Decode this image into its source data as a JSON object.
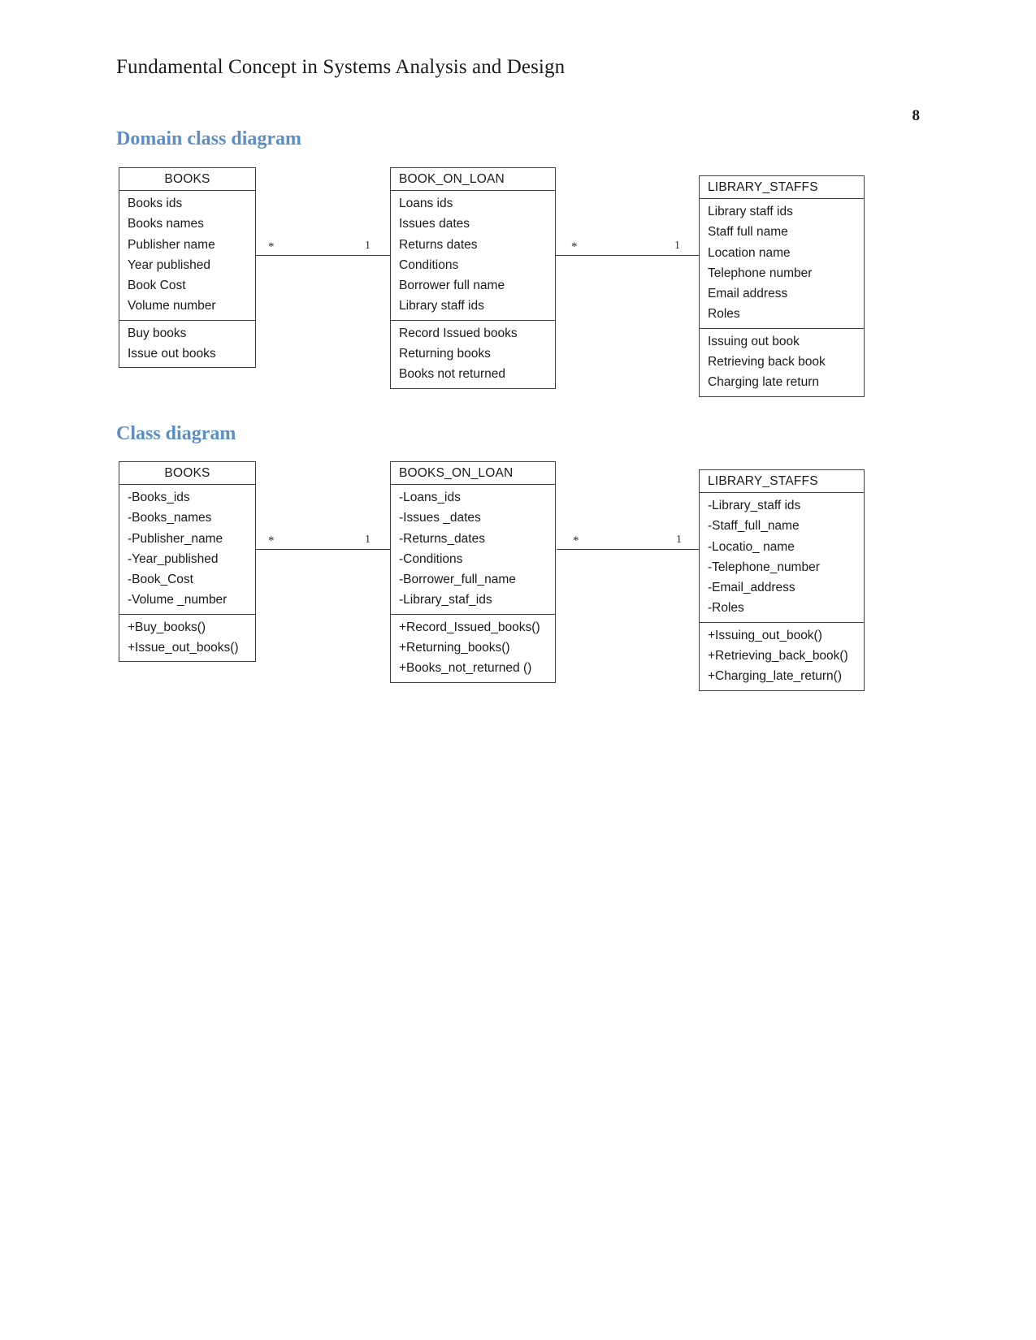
{
  "header": {
    "title": "Fundamental Concept in Systems Analysis and Design",
    "page_number": "8"
  },
  "sections": [
    {
      "id": "domain",
      "heading": "Domain class diagram",
      "classes": [
        {
          "name": "BOOKS",
          "attributes": [
            "Books ids",
            "Books names",
            "Publisher name",
            "Year published",
            "Book Cost",
            "Volume number"
          ],
          "operations": [
            "Buy books",
            "Issue out books"
          ]
        },
        {
          "name": "BOOK_ON_LOAN",
          "attributes": [
            "Loans ids",
            "Issues dates",
            "Returns dates",
            "Conditions",
            "Borrower full  name",
            "Library staff ids"
          ],
          "operations": [
            "Record Issued books",
            "Returning books",
            "Books not returned"
          ]
        },
        {
          "name": "LIBRARY_STAFFS",
          "attributes": [
            "Library staff ids",
            "Staff full name",
            "Location name",
            "Telephone number",
            "Email address",
            "Roles"
          ],
          "operations": [
            "Issuing out book",
            "Retrieving back book",
            "Charging late return"
          ]
        }
      ],
      "associations": [
        {
          "source_multiplicity": "*",
          "target_multiplicity": "1"
        },
        {
          "source_multiplicity": "*",
          "target_multiplicity": "1"
        }
      ]
    },
    {
      "id": "class",
      "heading": "Class diagram",
      "classes": [
        {
          "name": "BOOKS",
          "attributes": [
            "-Books_ids",
            "-Books_names",
            "-Publisher_name",
            "-Year_published",
            "-Book_Cost",
            "-Volume _number"
          ],
          "operations": [
            "+Buy_books()",
            "+Issue_out_books()"
          ]
        },
        {
          "name": "BOOKS_ON_LOAN",
          "attributes": [
            "-Loans_ids",
            "-Issues _dates",
            "-Returns_dates",
            "-Conditions",
            "-Borrower_full_name",
            "-Library_staf_ids"
          ],
          "operations": [
            "+Record_Issued_books()",
            "+Returning_books()",
            "+Books_not_returned ()"
          ]
        },
        {
          "name": "LIBRARY_STAFFS",
          "attributes": [
            "-Library_staff ids",
            "-Staff_full_name",
            "-Locatio_ name",
            "-Telephone_number",
            "-Email_address",
            "-Roles"
          ],
          "operations": [
            "+Issuing_out_book()",
            "+Retrieving_back_book()",
            "+Charging_late_return()"
          ]
        }
      ],
      "associations": [
        {
          "source_multiplicity": "*",
          "target_multiplicity": "1"
        },
        {
          "source_multiplicity": "*",
          "target_multiplicity": "1"
        }
      ]
    }
  ],
  "colors": {
    "heading": "#5b8ec4",
    "box_border": "#404040",
    "text": "#1a1a1a",
    "line": "#3a3a3a",
    "page_background": "#ffffff"
  }
}
